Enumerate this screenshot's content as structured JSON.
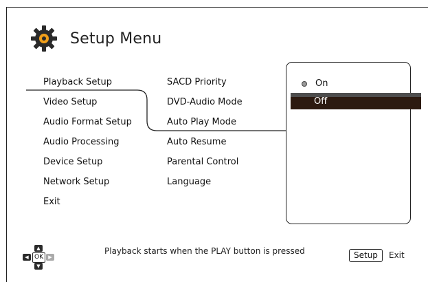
{
  "header": {
    "title": "Setup Menu",
    "icon": "gear-icon"
  },
  "main_menu": {
    "items": [
      {
        "label": "Playback Setup"
      },
      {
        "label": "Video Setup"
      },
      {
        "label": "Audio Format Setup"
      },
      {
        "label": "Audio Processing"
      },
      {
        "label": "Device Setup"
      },
      {
        "label": "Network Setup"
      },
      {
        "label": "Exit"
      }
    ],
    "selected": "Playback Setup"
  },
  "sub_menu": {
    "items": [
      {
        "label": "SACD Priority"
      },
      {
        "label": "DVD-Audio Mode"
      },
      {
        "label": "Auto Play Mode"
      },
      {
        "label": "Auto Resume"
      },
      {
        "label": "Parental Control"
      },
      {
        "label": "Language"
      }
    ],
    "selected": "Auto Play Mode"
  },
  "options": {
    "items": [
      {
        "label": "On",
        "current": true
      },
      {
        "label": "Off",
        "highlighted": true
      }
    ]
  },
  "footer": {
    "hint": "Playback starts when the PLAY button is pressed",
    "setup_button": "Setup",
    "exit_label": "Exit",
    "ok_key": "OK"
  },
  "colors": {
    "highlight": "#2c1a10",
    "highlight_top": "#4d4d4d",
    "line": "#222222"
  }
}
